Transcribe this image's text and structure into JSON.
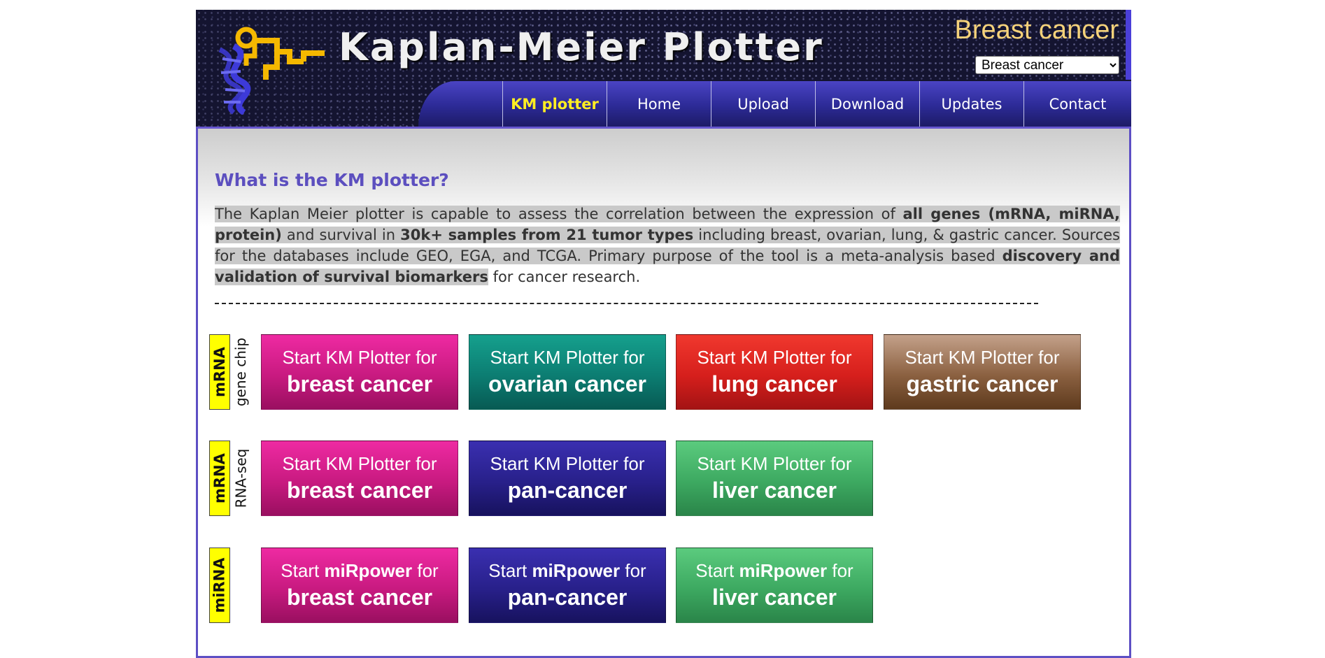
{
  "header": {
    "site_title": "Kaplan-Meier Plotter",
    "cancer_title": "Breast cancer",
    "cancer_select_value": "Breast cancer",
    "nav": [
      {
        "label": "KM plotter",
        "active": true
      },
      {
        "label": "Home"
      },
      {
        "label": "Upload"
      },
      {
        "label": "Download"
      },
      {
        "label": "Updates"
      },
      {
        "label": "Contact"
      }
    ]
  },
  "main": {
    "heading": "What is the KM plotter?",
    "intro": {
      "t1": "The Kaplan Meier plotter is capable to assess the correlation between the expression of ",
      "b1": "all genes (mRNA, miRNA, protein)",
      "t2": " and survival in ",
      "b2": "30k+ samples from 21 tumor types",
      "t3": " including breast, ovarian, lung, & gastric cancer. Sources for the databases include GEO, EGA, and TCGA. Primary purpose of the tool is a meta-analysis based ",
      "b3": "discovery and validation of survival biomarkers",
      "t4": " for cancer research."
    },
    "divider": "----------------------------------------------------------------------------------------------------------------------------"
  },
  "rows": [
    {
      "label": "mRNA",
      "sublabel": "gene chip",
      "buttons": [
        {
          "line1": "Start KM Plotter for",
          "line2": "breast cancer"
        },
        {
          "line1": "Start KM Plotter for",
          "line2": "ovarian cancer"
        },
        {
          "line1": "Start KM Plotter for",
          "line2": "lung cancer"
        },
        {
          "line1": "Start KM Plotter for",
          "line2": "gastric cancer"
        }
      ]
    },
    {
      "label": "mRNA",
      "sublabel": "RNA-seq",
      "buttons": [
        {
          "line1": "Start KM Plotter for",
          "line2": "breast cancer"
        },
        {
          "line1": "Start KM Plotter for",
          "line2": "pan-cancer"
        },
        {
          "line1": "Start KM Plotter for",
          "line2": "liver cancer"
        }
      ]
    },
    {
      "label": "miRNA",
      "sublabel": "",
      "buttons": [
        {
          "pre": "Start ",
          "bold": "miRpower",
          "post": " for",
          "line2": "breast cancer"
        },
        {
          "pre": "Start ",
          "bold": "miRpower",
          "post": " for",
          "line2": "pan-cancer"
        },
        {
          "pre": "Start ",
          "bold": "miRpower",
          "post": " for",
          "line2": "liver cancer"
        }
      ]
    }
  ],
  "colors": {
    "accent": "#5c4fbf",
    "label_yellow": "#ffff00",
    "pink": "#c81a80",
    "teal": "#0c7d72",
    "red": "#d61f1c",
    "brown": "#8a6040",
    "indigo": "#28208a",
    "green": "#3da961",
    "nav_active": "#ffee22"
  }
}
